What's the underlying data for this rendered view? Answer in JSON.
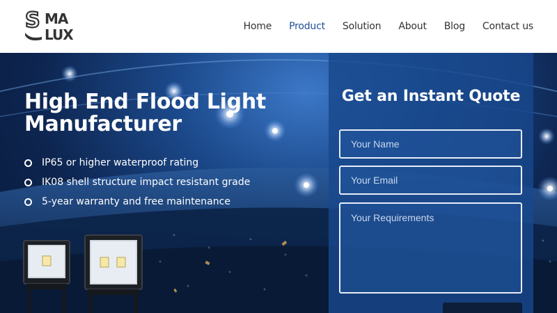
{
  "brand": {
    "logo_text_top": "SMA",
    "logo_text_bottom": "LUX"
  },
  "nav": {
    "items": [
      {
        "label": "Home",
        "active": false
      },
      {
        "label": "Product",
        "active": true
      },
      {
        "label": "Solution",
        "active": false
      },
      {
        "label": "About",
        "active": false
      },
      {
        "label": "Blog",
        "active": false
      },
      {
        "label": "Contact us",
        "active": false
      }
    ]
  },
  "hero": {
    "title": "High End Flood Light Manufacturer",
    "features": [
      "IP65 or higher waterproof rating",
      "IK08 shell structure impact resistant grade",
      "5-year warranty and free maintenance"
    ]
  },
  "quote_form": {
    "title": "Get an Instant Quote",
    "name_placeholder": "Your Name",
    "email_placeholder": "Your Email",
    "requirements_placeholder": "Your Requirements",
    "submit_label": ""
  },
  "colors": {
    "nav_active": "#1f4e96",
    "panel": "#18488c",
    "submit": "#0c1e3a"
  }
}
